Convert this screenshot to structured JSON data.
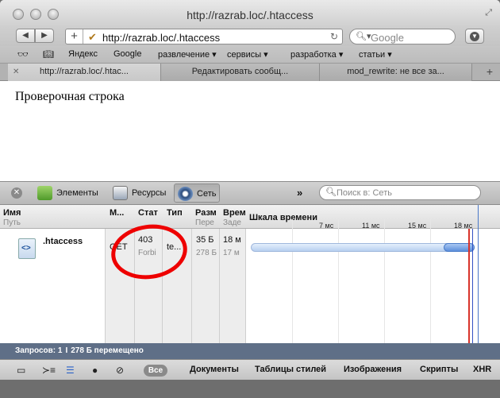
{
  "window": {
    "title": "http://razrab.loc/.htaccess"
  },
  "toolbar": {
    "back": "◀",
    "forward": "▶",
    "new_tab": "+",
    "url": "http://razrab.loc/.htaccess",
    "search_placeholder": "Google"
  },
  "bookmarks": [
    "Яндекс",
    "Google",
    "развлечение ▾",
    "сервисы ▾",
    "разработка ▾",
    "статьи ▾"
  ],
  "tabs": [
    {
      "label": "http://razrab.loc/.htac..."
    },
    {
      "label": "Редактировать сообщ..."
    },
    {
      "label": "mod_rewrite: не все за..."
    }
  ],
  "page": {
    "text": "Проверочная строка"
  },
  "inspector": {
    "buttons": [
      "Элементы",
      "Ресурсы",
      "Сеть"
    ],
    "more": "»",
    "search_placeholder": "Поиск в: Сеть"
  },
  "network": {
    "columns": [
      {
        "title": "Имя",
        "sub": "Путь"
      },
      {
        "title": "М...",
        "sub": ""
      },
      {
        "title": "Стат",
        "sub": ""
      },
      {
        "title": "Тип",
        "sub": ""
      },
      {
        "title": "Разм",
        "sub": "Пере"
      },
      {
        "title": "Врем",
        "sub": "Заде"
      },
      {
        "title": "Шкала времени",
        "sub": ""
      }
    ],
    "ticks": [
      "7 мс",
      "11 мс",
      "15 мс",
      "18 мс"
    ],
    "rows": [
      {
        "name": ".htaccess",
        "method": "GET",
        "status": "403",
        "status_text": "Forbi",
        "type": "te...",
        "size": "35 Б",
        "transferred": "278 Б",
        "time": "18 м",
        "latency": "17 м"
      }
    ]
  },
  "status": {
    "requests": "Запросов: 1",
    "separator": "I",
    "transferred": "278 Б перемещено"
  },
  "filters": {
    "all": "Все",
    "items": [
      "Документы",
      "Таблицы стилей",
      "Изображения",
      "Скрипты",
      "XHR"
    ]
  },
  "colors": {
    "status_bar": "#5f6f87",
    "annotation": "#ee0000"
  }
}
